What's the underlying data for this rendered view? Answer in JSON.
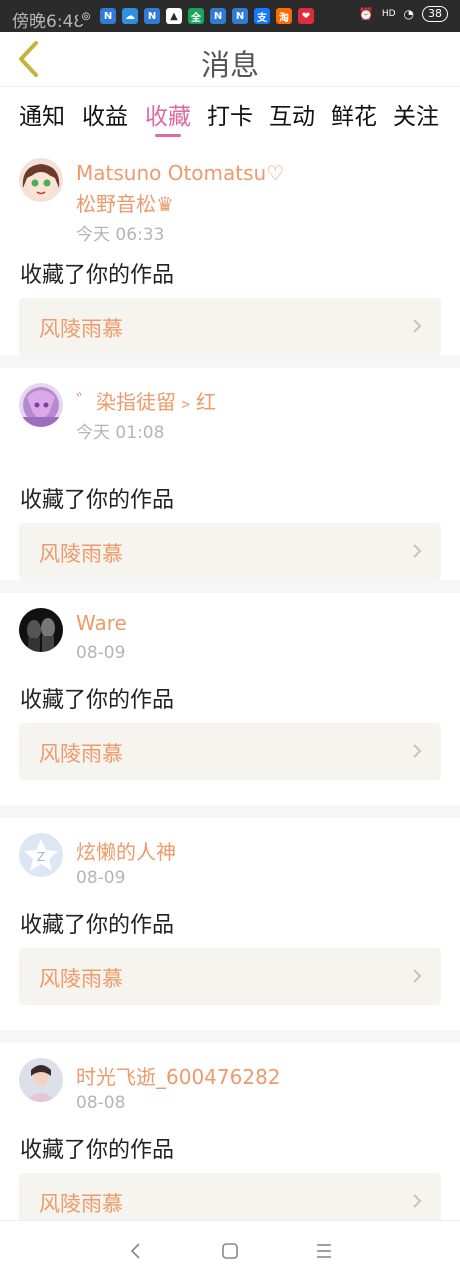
{
  "status_bar": {
    "time": "傍晚6:48",
    "battery": "38",
    "network": "HD",
    "apps": [
      {
        "icon": "wechat-icon",
        "glyph": "◎",
        "color": "#2b2b2b"
      },
      {
        "icon": "n-app-icon",
        "glyph": "N",
        "color": "#2f7bd6"
      },
      {
        "icon": "cloud-app-icon",
        "glyph": "☁",
        "color": "#2f8fe0"
      },
      {
        "icon": "n-app-icon",
        "glyph": "N",
        "color": "#2f7bd6"
      },
      {
        "icon": "drive-app-icon",
        "glyph": "▲",
        "color": "#ffffff"
      },
      {
        "icon": "quan-app-icon",
        "glyph": "全",
        "color": "#1aa35a"
      },
      {
        "icon": "n-app-icon",
        "glyph": "N",
        "color": "#2f7bd6"
      },
      {
        "icon": "n-app-icon",
        "glyph": "N",
        "color": "#2f7bd6"
      },
      {
        "icon": "alipay-icon",
        "glyph": "支",
        "color": "#1677ff"
      },
      {
        "icon": "taobao-icon",
        "glyph": "淘",
        "color": "#ff6a00"
      },
      {
        "icon": "heart-app-icon",
        "glyph": "❤",
        "color": "#e02b3c"
      }
    ]
  },
  "header": {
    "title": "消息"
  },
  "tabs": [
    {
      "label": "通知"
    },
    {
      "label": "收益"
    },
    {
      "label": "收藏"
    },
    {
      "label": "打卡"
    },
    {
      "label": "互动"
    },
    {
      "label": "鲜花"
    },
    {
      "label": "关注"
    }
  ],
  "active_tab": 2,
  "feed": [
    {
      "username": "Matsuno Otomatsu♡",
      "sublabel": "松野音松♛",
      "time": "今天 06:33",
      "action": "收藏了你的作品",
      "work": "风陵雨慕",
      "avatar": "anime-girl-avatar"
    },
    {
      "username": "゛染指徒留﹥红",
      "sublabel": "",
      "time": "今天 01:08",
      "action": "收藏了你的作品",
      "work": "风陵雨慕",
      "avatar": "purple-anime-avatar"
    },
    {
      "username": "Ware",
      "sublabel": "",
      "time": "08-09",
      "action": "收藏了你的作品",
      "work": "风陵雨慕",
      "avatar": "dark-photo-avatar"
    },
    {
      "username": "炫懒的人神",
      "sublabel": "",
      "time": "08-09",
      "action": "收藏了你的作品",
      "work": "风陵雨慕",
      "avatar": "default-avatar"
    },
    {
      "username": "时光飞逝_600476282",
      "sublabel": "",
      "time": "08-08",
      "action": "收藏了你的作品",
      "work": "风陵雨慕",
      "avatar": "person-photo-avatar"
    }
  ],
  "colors": {
    "accent": "#e0699f",
    "username": "#ee9a6b",
    "card_bg": "#f5f4ee",
    "back_arrow": "#c9b23a"
  }
}
